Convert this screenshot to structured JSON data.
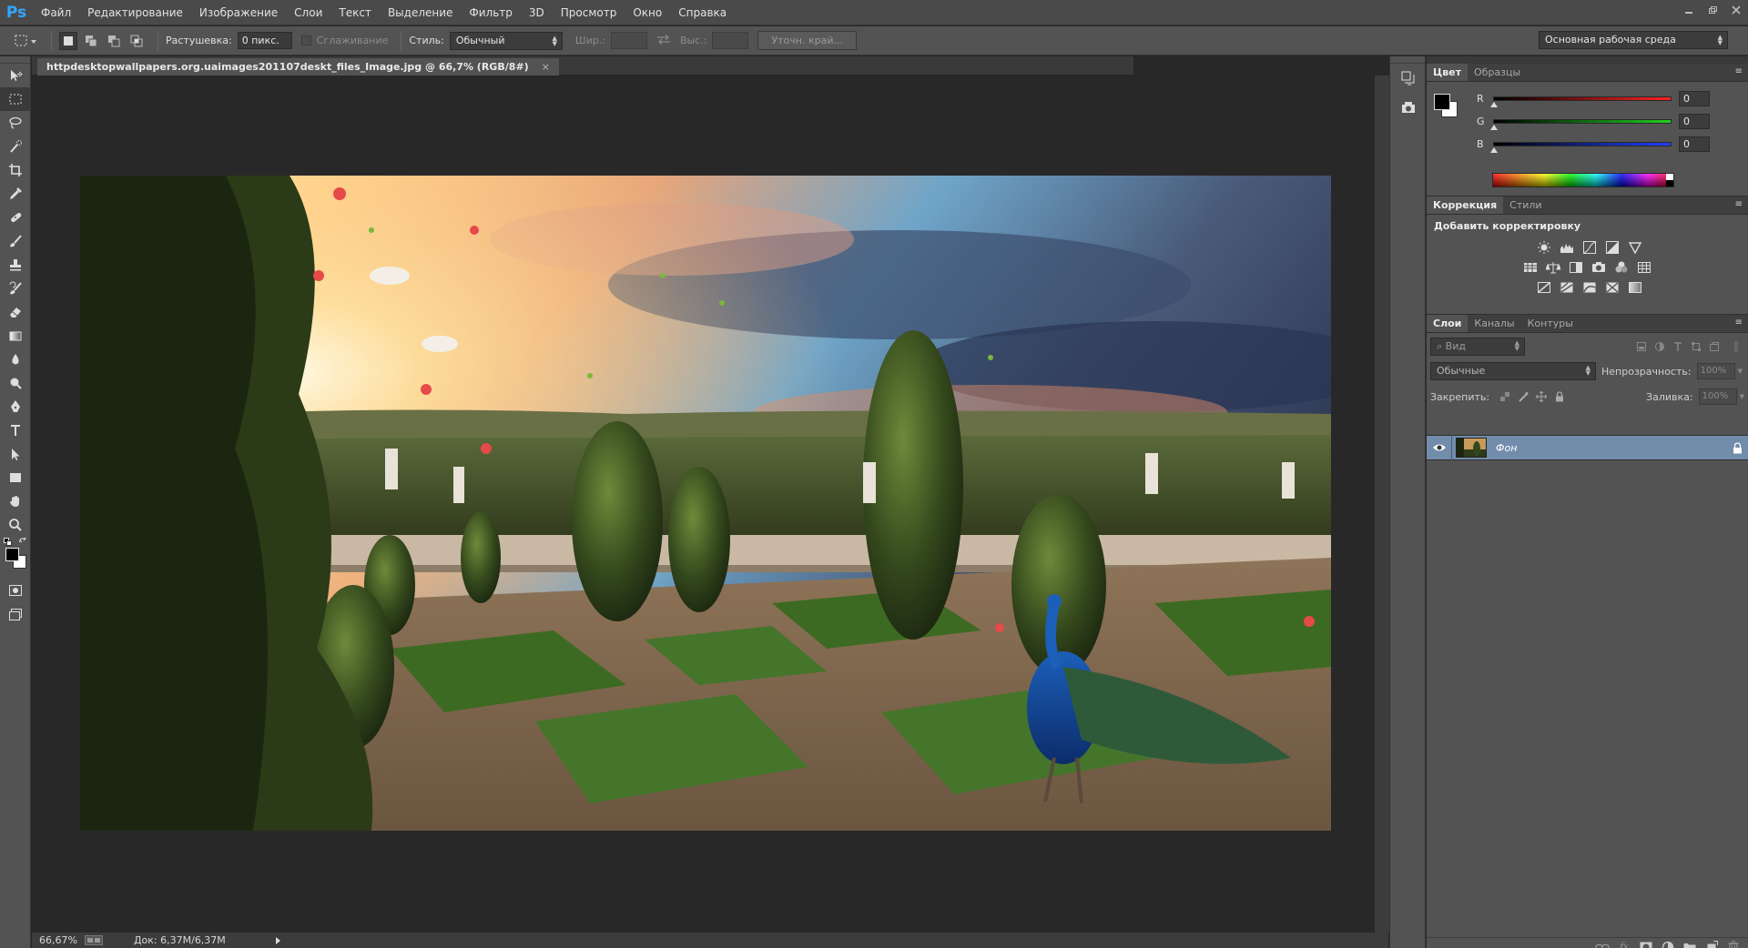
{
  "app": {
    "logo": "Ps"
  },
  "menu": [
    "Файл",
    "Редактирование",
    "Изображение",
    "Слои",
    "Текст",
    "Выделение",
    "Фильтр",
    "3D",
    "Просмотр",
    "Окно",
    "Справка"
  ],
  "options": {
    "feather_label": "Растушевка:",
    "feather_value": "0 пикс.",
    "antialias_label": "Сглаживание",
    "style_label": "Стиль:",
    "style_value": "Обычный",
    "width_label": "Шир.:",
    "height_label": "Выс.:",
    "refine_edge_label": "Уточн. край...",
    "workspace_value": "Основная рабочая среда"
  },
  "document": {
    "tab_title": "httpdesktopwallpapers.org.uaimages201107deskt_files_Image.jpg @ 66,7% (RGB/8#)",
    "tab_close": "×"
  },
  "status": {
    "zoom": "66,67%",
    "doc_size": "Док: 6,37M/6,37M"
  },
  "color_panel": {
    "tabs": [
      "Цвет",
      "Образцы"
    ],
    "r_label": "R",
    "g_label": "G",
    "b_label": "B",
    "r_value": "0",
    "g_value": "0",
    "b_value": "0",
    "colors": {
      "r": "#ff2020",
      "g": "#20d020",
      "b": "#2040ff"
    }
  },
  "adjustments_panel": {
    "tabs": [
      "Коррекция",
      "Стили"
    ],
    "title": "Добавить корректировку"
  },
  "layers_panel": {
    "tabs": [
      "Слои",
      "Каналы",
      "Контуры"
    ],
    "filter_value": "Вид",
    "blend_mode": "Обычные",
    "opacity_label": "Непрозрачность:",
    "opacity_value": "100%",
    "lock_label": "Закрепить:",
    "fill_label": "Заливка:",
    "fill_value": "100%",
    "layers": [
      {
        "name": "Фон",
        "visible": true,
        "locked": true
      }
    ]
  },
  "icons": {
    "tools": [
      "move-icon",
      "marquee-icon",
      "lasso-icon",
      "quick-select-icon",
      "crop-icon",
      "eyedropper-icon",
      "healing-brush-icon",
      "brush-icon",
      "stamp-icon",
      "history-brush-icon",
      "eraser-icon",
      "gradient-icon",
      "blur-icon",
      "dodge-icon",
      "pen-icon",
      "type-icon",
      "path-select-icon",
      "shape-icon",
      "hand-icon",
      "zoom-icon"
    ]
  }
}
